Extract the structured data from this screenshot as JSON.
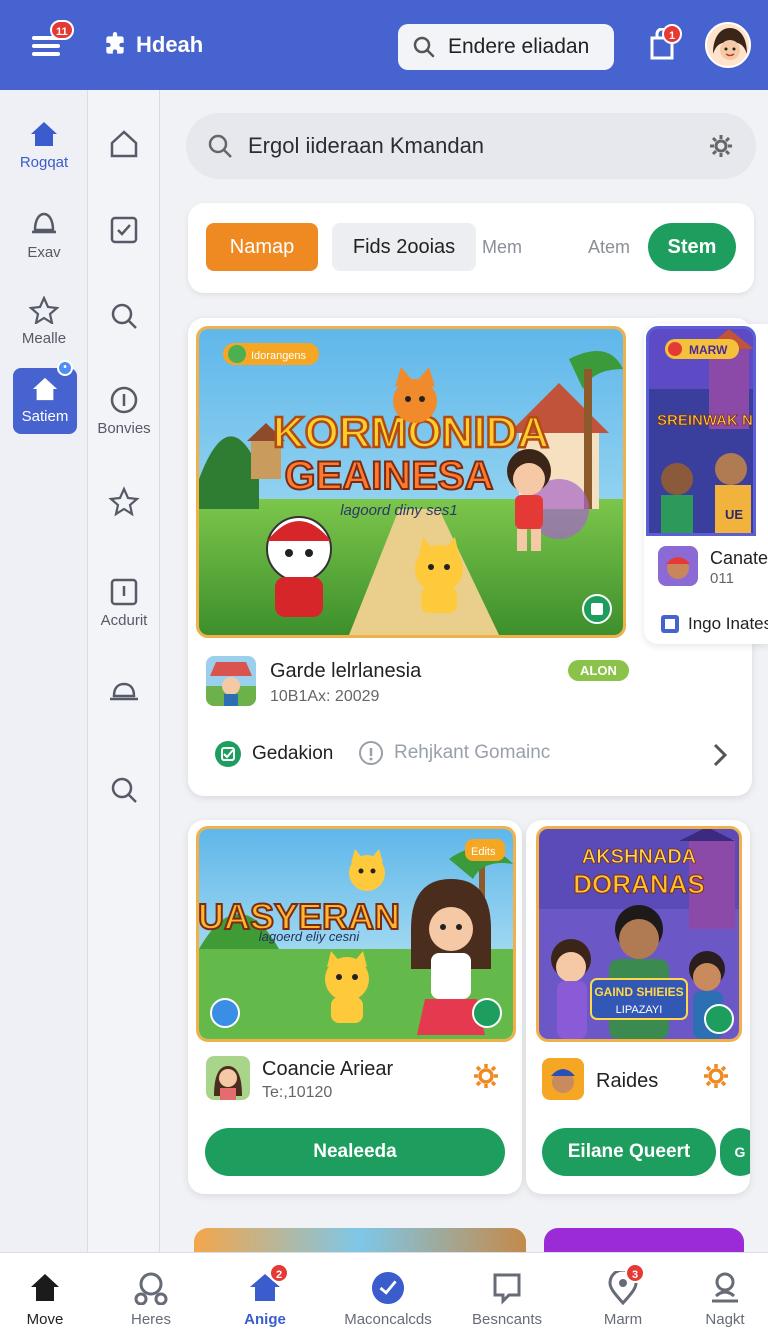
{
  "topbar": {
    "menu_badge": "11",
    "brand": "Hdeah",
    "search_text": "Endere eliadan",
    "notif_badge": "1"
  },
  "rail": [
    {
      "label": "Rogqat",
      "icon": "home-icon"
    },
    {
      "label": "Exav",
      "icon": "bell-icon"
    },
    {
      "label": "Mealle",
      "icon": "star-icon"
    },
    {
      "label": "Satiem",
      "icon": "home-icon",
      "active": true
    }
  ],
  "rail2": [
    {
      "label": "",
      "icon": "home-icon"
    },
    {
      "label": "",
      "icon": "checkbox-icon"
    },
    {
      "label": "",
      "icon": "search-icon"
    },
    {
      "label": "Bonvies",
      "icon": "info-icon"
    },
    {
      "label": "",
      "icon": "star-icon"
    },
    {
      "label": "Acdurit",
      "icon": "info-square-icon"
    },
    {
      "label": "",
      "icon": "bell-icon"
    },
    {
      "label": "",
      "icon": "search-icon"
    }
  ],
  "search": {
    "text": "Ergol iideraan Kmandan"
  },
  "chips": [
    "Namap",
    "Fids 2ooias",
    "Mem",
    "Atem",
    "Stem"
  ],
  "featured": {
    "tag": "Idorangens",
    "banner_line1": "KORMONIDA",
    "banner_line2": "GEAINESA",
    "banner_sub": "lagoord diny ses1",
    "title": "Garde lelrlanesia",
    "subtitle": "10B1Ax: 20029",
    "pill": "ALON",
    "action1": "Gedakion",
    "action2": "Rehjkant Gomainc"
  },
  "side_card": {
    "tag": "MARW",
    "banner": "SREINWAK NENS!",
    "badge": "UE",
    "title": "Canate",
    "subtitle": "011",
    "footer": "Ingo Inates"
  },
  "card_a": {
    "tag": "Edits",
    "banner": "UASYERAN",
    "banner_sub": "lagoerd eliy cesni",
    "title": "Coancie Ariear",
    "subtitle": "Te:,10120",
    "button": "Nealeeda"
  },
  "card_b": {
    "banner_line1": "AKSHNADA",
    "banner_line2": "DORANAS",
    "banner_line3": "GAIND SHIEIES",
    "banner_line4": "LIPAZAYI",
    "title": "Raides",
    "button": "Eilane Queert",
    "edge_label": "G"
  },
  "bottomnav": [
    {
      "label": "Move",
      "icon": "home-icon"
    },
    {
      "label": "Heres",
      "icon": "people-icon"
    },
    {
      "label": "Anige",
      "icon": "home-icon",
      "badge": "2",
      "active": true
    },
    {
      "label": "Maconcalcds",
      "icon": "check-circle-icon"
    },
    {
      "label": "Besncants",
      "icon": "chat-icon"
    },
    {
      "label": "Marm",
      "icon": "pin-icon",
      "badge": "3"
    },
    {
      "label": "Nagkt",
      "icon": "person-icon"
    }
  ]
}
